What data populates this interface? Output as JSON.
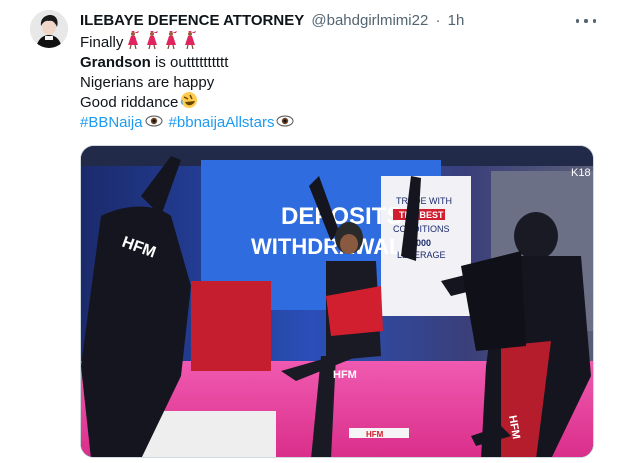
{
  "tweet": {
    "author_name": "ILEBAYE DEFENCE ATTORNEY",
    "handle": "@bahdgirlmimi22",
    "separator": "·",
    "time": "1h",
    "lines": [
      {
        "text": "Finally",
        "emoji": "dancer-emoji"
      },
      {
        "bold": "Grandson",
        "text": " is outttttttttt"
      },
      {
        "text": "Nigerians are happy"
      },
      {
        "text": "Good riddance",
        "emoji": "rolling-laughing-emoji"
      }
    ],
    "hashtags": [
      "#BBNaija",
      "#bbnaijaAllstars"
    ],
    "hashtag_emoji": "eye-emoji"
  },
  "media": {
    "sign_line1": "DEPOSITS",
    "sign_line2": "WITHDRAWALS",
    "banner_line1": "TRADE WITH",
    "banner_highlight": "THE BEST",
    "banner_line3": "CONDITIONS",
    "banner_line4": "1:1000",
    "banner_line5": "LEVERAGE",
    "logo_text": "HFM",
    "corner_tag": "K18"
  },
  "colors": {
    "text": "#0f1419",
    "secondary": "#536471",
    "link": "#1d9bf0",
    "stage_pink": "#e6409a",
    "outfit_red": "#d11f2f"
  }
}
